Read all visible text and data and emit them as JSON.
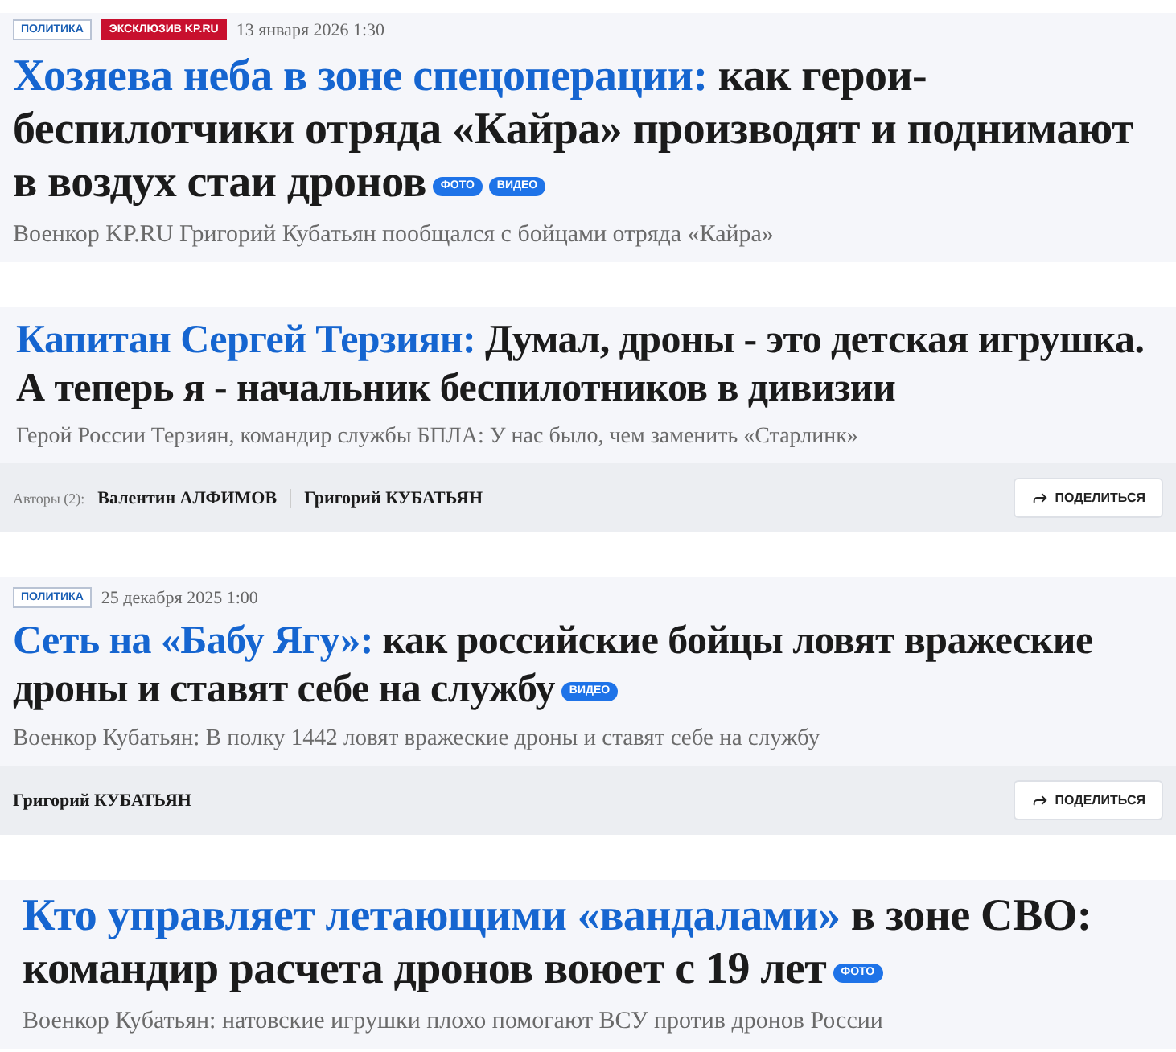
{
  "articles": [
    {
      "tags": [
        {
          "label": "ПОЛИТИКА",
          "kind": "rubric"
        },
        {
          "label": "ЭКСКЛЮЗИВ KP.RU",
          "kind": "exclusive"
        }
      ],
      "date": "13 января 2026 1:30",
      "headline_lead": "Хозяева неба в зоне спецоперации:",
      "headline_rest": "как герои-беспилотчики отряда «Кайра» производят и поднимают в воздух стаи дронов",
      "media": [
        "ФОТО",
        "ВИДЕО"
      ],
      "subtitle": "Военкор KP.RU Григорий Кубатьян пообщался с бойцами отряда «Кайра»"
    },
    {
      "headline_lead": "Капитан Сергей Терзиян:",
      "headline_rest": "Думал, дроны - это детская игрушка. А теперь я - начальник беспилотников в дивизии",
      "subtitle": "Герой России Терзиян, командир службы БПЛА: У нас было, чем заменить «Старлинк»",
      "footer": {
        "authors_label": "Авторы (2):",
        "authors": [
          "Валентин АЛФИМОВ",
          "Григорий КУБАТЬЯН"
        ],
        "share": "ПОДЕЛИТЬСЯ"
      }
    },
    {
      "tags": [
        {
          "label": "ПОЛИТИКА",
          "kind": "rubric"
        }
      ],
      "date": "25 декабря 2025 1:00",
      "headline_lead": "Сеть на «Бабу Ягу»:",
      "headline_rest": "как российские бойцы ловят вражеские дроны и ставят себе на службу",
      "media": [
        "ВИДЕО"
      ],
      "subtitle": "Военкор Кубатьян: В полку 1442 ловят вражеские дроны и ставят себе на службу",
      "footer": {
        "authors": [
          "Григорий КУБАТЬЯН"
        ],
        "share": "ПОДЕЛИТЬСЯ"
      }
    },
    {
      "headline_lead": "Кто управляет летающими «вандалами»",
      "headline_rest": "в зоне СВО: командир расчета дронов воюет с 19 лет",
      "media": [
        "ФОТО"
      ],
      "subtitle": "Военкор Кубатьян: натовские игрушки плохо помогают ВСУ против дронов России"
    }
  ]
}
